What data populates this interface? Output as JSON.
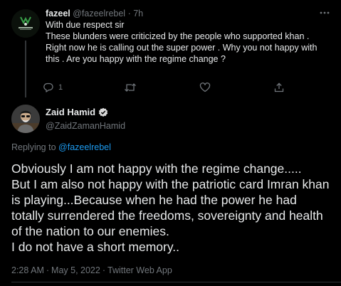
{
  "reply_tweet": {
    "author_name": "fazeel",
    "author_handle": "@fazeelrebel",
    "separator": "·",
    "time": "7h",
    "more_icon": "more-horizontal-icon",
    "text_lines": [
      "With due respect sir",
      "These blunders were criticized by  the people who supported khan . Right now he is calling out the super power . Why you not happy with  this . Are you happy with the regime change ?"
    ],
    "actions": {
      "reply_count": "1",
      "retweet_count": "",
      "like_count": ""
    }
  },
  "main_tweet": {
    "author_name": "Zaid Hamid",
    "author_handle": "@ZaidZamanHamid",
    "verified": true,
    "replying_prefix": "Replying to",
    "replying_to": "@fazeelrebel",
    "text_lines": [
      "Obviously I am not happy with the regime change.....",
      "But I am also not happy with the patriotic card Imran khan is playing...Because when he had the power he had totally surrendered the freedoms, sovereignty and health of the nation to our enemies.",
      "I do not have a short memory.."
    ],
    "time": "2:28 AM",
    "date": "May 5, 2022",
    "source": "Twitter Web App",
    "separator": "·"
  },
  "colors": {
    "background": "#000000",
    "text": "#e7e9ea",
    "muted": "#71767b",
    "link": "#1d9bf0",
    "verified_badge": "#d9d9d9",
    "divider": "#2f3336"
  }
}
